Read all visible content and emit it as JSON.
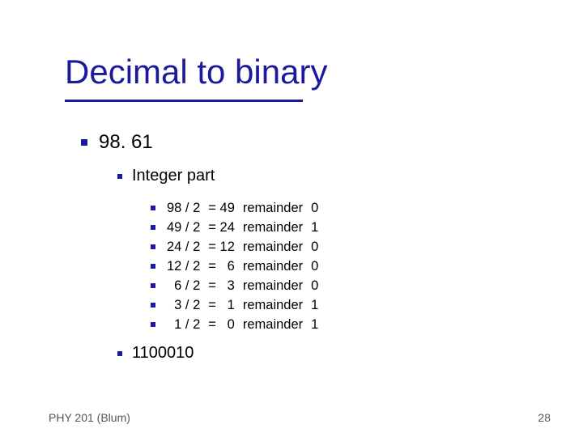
{
  "title": "Decimal to binary",
  "number": "98. 61",
  "subhead": "Integer part",
  "steps": [
    {
      "div": "98 / 2",
      "eq": "= 49",
      "rem": "remainder",
      "r": "0"
    },
    {
      "div": "49 / 2",
      "eq": "= 24",
      "rem": "remainder",
      "r": "1"
    },
    {
      "div": "24 / 2",
      "eq": "= 12",
      "rem": "remainder",
      "r": "0"
    },
    {
      "div": "12 / 2",
      "eq": "=   6",
      "rem": "remainder",
      "r": "0"
    },
    {
      "div": "  6 / 2",
      "eq": "=   3",
      "rem": "remainder",
      "r": "0"
    },
    {
      "div": "  3 / 2",
      "eq": "=   1",
      "rem": "remainder",
      "r": "1"
    },
    {
      "div": "  1 / 2",
      "eq": "=   0",
      "rem": "remainder",
      "r": "1"
    }
  ],
  "result": "1100010",
  "footer_left": "PHY 201 (Blum)",
  "footer_right": "28"
}
